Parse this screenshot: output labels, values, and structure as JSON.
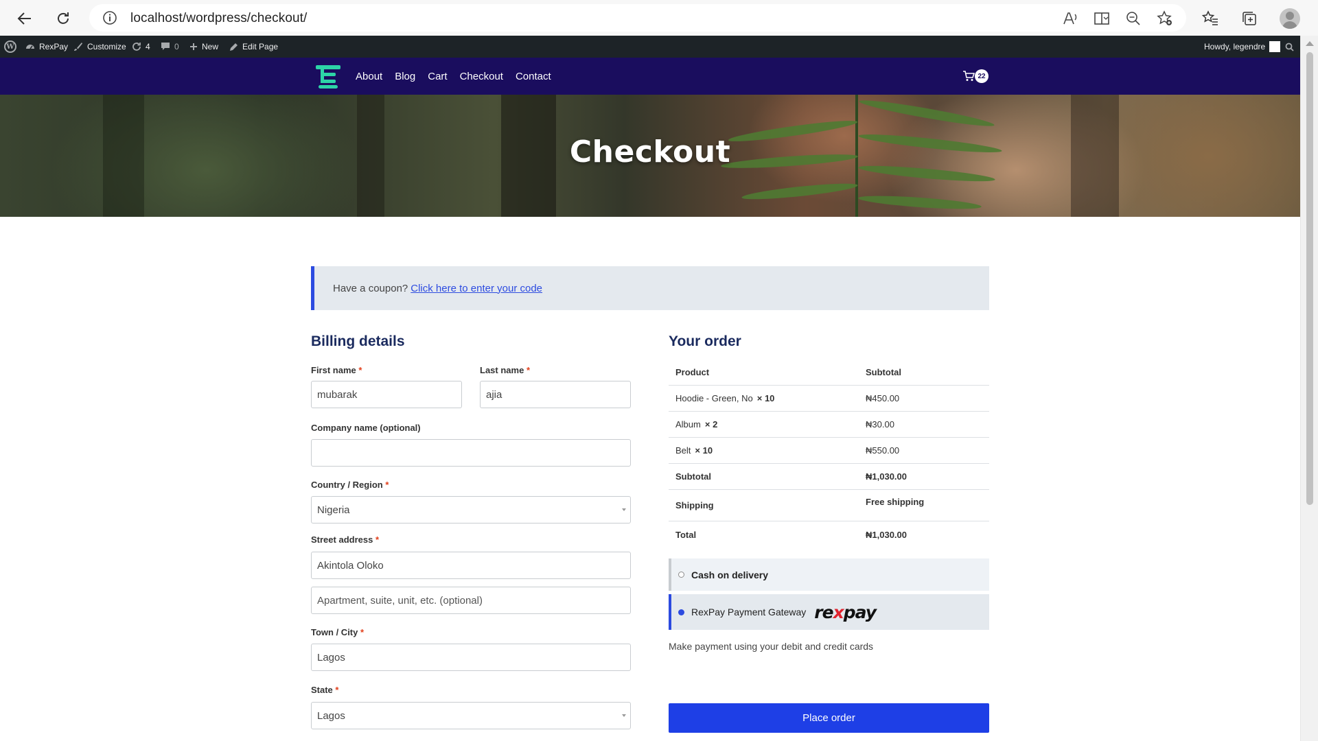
{
  "browser": {
    "url": "localhost/wordpress/checkout/"
  },
  "admin_bar": {
    "site_name": "RexPay",
    "customize": "Customize",
    "updates_count": "4",
    "comments_count": "0",
    "new": "New",
    "edit_page": "Edit Page",
    "howdy": "Howdy, legendre"
  },
  "header": {
    "nav": [
      "About",
      "Blog",
      "Cart",
      "Checkout",
      "Contact"
    ],
    "cart_count": "22"
  },
  "hero": {
    "title": "Checkout"
  },
  "coupon": {
    "text": "Have a coupon?",
    "link": "Click here to enter your code"
  },
  "billing": {
    "title": "Billing details",
    "first_name": {
      "label": "First name",
      "value": "mubarak"
    },
    "last_name": {
      "label": "Last name",
      "value": "ajia"
    },
    "company": {
      "label": "Company name (optional)",
      "value": ""
    },
    "country": {
      "label": "Country / Region",
      "value": "Nigeria"
    },
    "street": {
      "label": "Street address",
      "value": "Akintola Oloko",
      "placeholder2": "Apartment, suite, unit, etc. (optional)"
    },
    "city": {
      "label": "Town / City",
      "value": "Lagos"
    },
    "state": {
      "label": "State",
      "value": "Lagos"
    },
    "required_mark": "*"
  },
  "order": {
    "title": "Your order",
    "col_product": "Product",
    "col_subtotal": "Subtotal",
    "items": [
      {
        "name": "Hoodie - Green, No",
        "qty": "× 10",
        "price": "₦450.00"
      },
      {
        "name": "Album",
        "qty": "× 2",
        "price": "₦30.00"
      },
      {
        "name": "Belt",
        "qty": "× 10",
        "price": "₦550.00"
      }
    ],
    "subtotal_label": "Subtotal",
    "subtotal_value": "₦1,030.00",
    "shipping_label": "Shipping",
    "shipping_value": "Free shipping",
    "total_label": "Total",
    "total_value": "₦1,030.00"
  },
  "payment": {
    "cod_label": "Cash on delivery",
    "rexpay_label": "RexPay Payment Gateway",
    "rexpay_logo_pre": "re",
    "rexpay_logo_x": "x",
    "rexpay_logo_post": "pay",
    "description": "Make payment using your debit and credit cards",
    "place_order": "Place order"
  }
}
